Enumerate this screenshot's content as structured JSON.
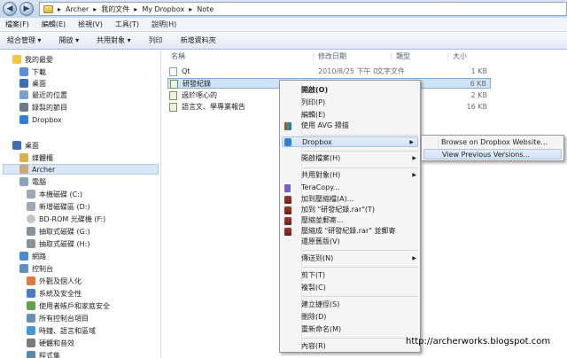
{
  "address": {
    "segments": [
      "Archer",
      "我的文件",
      "My Dropbox",
      "Note"
    ],
    "separator": "▸"
  },
  "menubar": [
    "檔案(F)",
    "編輯(E)",
    "檢視(V)",
    "工具(T)",
    "說明(H)"
  ],
  "toolbar": [
    "組合管理 ▾",
    "開啟 ▾",
    "共用對象 ▾",
    "列印",
    "新增資料夾"
  ],
  "sidebar": {
    "favorites": {
      "label": "我的最愛",
      "items": [
        "下載",
        "桌面",
        "最近的位置",
        "錄製的節目",
        "Dropbox"
      ]
    },
    "desktop": {
      "label": "桌面",
      "items": [
        "媒體櫃",
        "Archer"
      ]
    },
    "computer": {
      "label": "電腦",
      "items": [
        "本機磁碟 (C:)",
        "新增磁碟區 (D:)",
        "BD-ROM 光碟機 (F:)",
        "抽取式磁碟 (G:)",
        "抽取式磁碟 (H:)"
      ]
    },
    "network": "網路",
    "control": {
      "label": "控制台",
      "items": [
        "外觀及個人化",
        "系統及安全性",
        "使用者帳戶和家庭安全",
        "所有控制台項目",
        "時鐘、語言和區域",
        "硬體和音效",
        "程式集"
      ]
    }
  },
  "columns": [
    "名稱",
    "修改日期",
    "類型",
    "大小"
  ],
  "files": [
    {
      "name": "Qt",
      "date": "2010/8/25 下午 0...",
      "type": "文字文件",
      "size": "1 KB"
    },
    {
      "name": "研發紀錄",
      "date": "",
      "type": "",
      "size": "6 KB"
    },
    {
      "name": "過於噁心的",
      "date": "",
      "type": "",
      "size": "2 KB"
    },
    {
      "name": "語言文、學專業報告",
      "date": "",
      "type": "",
      "size": "16 KB"
    }
  ],
  "context_menu": [
    "開啟(O)",
    "列印(P)",
    "編輯(E)",
    "使用 AVG 掃描",
    "Dropbox",
    "開啟檔案(H)",
    "共用對象(H)",
    "TeraCopy...",
    "加到壓縮檔(A)...",
    "加到 \"研發紀錄.rar\"(T)",
    "壓縮並郵寄...",
    "壓縮成 \"研發紀錄.rar\" 並郵寄",
    "還原舊版(V)",
    "傳送到(N)",
    "剪下(T)",
    "複製(C)",
    "建立捷徑(S)",
    "刪除(D)",
    "重新命名(M)",
    "內容(R)"
  ],
  "submenu": [
    "Browse on Dropbox Website...",
    "View Previous Versions..."
  ],
  "watermark": "http://archerworks.blogspot.com",
  "colors": {
    "selection": "#cde4fb",
    "menu_highlight": "#d1e2f6"
  }
}
